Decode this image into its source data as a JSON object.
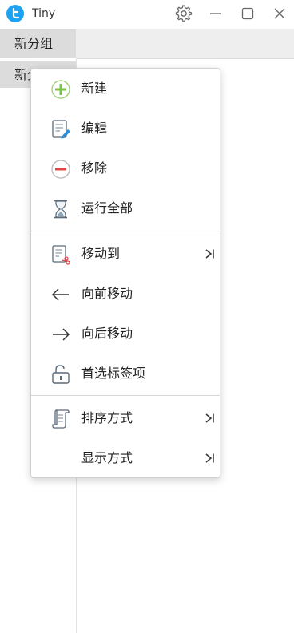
{
  "app": {
    "title": "Tiny",
    "logo_color": "#1da1f2"
  },
  "titlebar": {
    "icons": [
      "gear-icon",
      "minimize-icon",
      "maximize-icon",
      "close-icon"
    ]
  },
  "tabs": [
    {
      "label": "新分组"
    }
  ],
  "groups": [
    {
      "label": "新分组"
    }
  ],
  "context_menu": {
    "items": [
      {
        "label": "新建",
        "icon": "add-icon",
        "has_submenu": false
      },
      {
        "label": "编辑",
        "icon": "edit-icon",
        "has_submenu": false
      },
      {
        "label": "移除",
        "icon": "remove-icon",
        "has_submenu": false
      },
      {
        "label": "运行全部",
        "icon": "hourglass-icon",
        "has_submenu": false
      },
      {
        "label": "移动到",
        "icon": "move-to-icon",
        "has_submenu": true
      },
      {
        "label": "向前移动",
        "icon": "arrow-left-icon",
        "has_submenu": false
      },
      {
        "label": "向后移动",
        "icon": "arrow-right-icon",
        "has_submenu": false
      },
      {
        "label": "首选标签项",
        "icon": "unlock-icon",
        "has_submenu": false
      },
      {
        "label": "排序方式",
        "icon": "scroll-icon",
        "has_submenu": true
      },
      {
        "label": "显示方式",
        "icon": "",
        "has_submenu": true
      }
    ]
  },
  "colors": {
    "add_green": "#7cc242",
    "remove_red": "#e04848",
    "edit_blue": "#2f8fd8",
    "icon_gray": "#5a6b7b"
  }
}
